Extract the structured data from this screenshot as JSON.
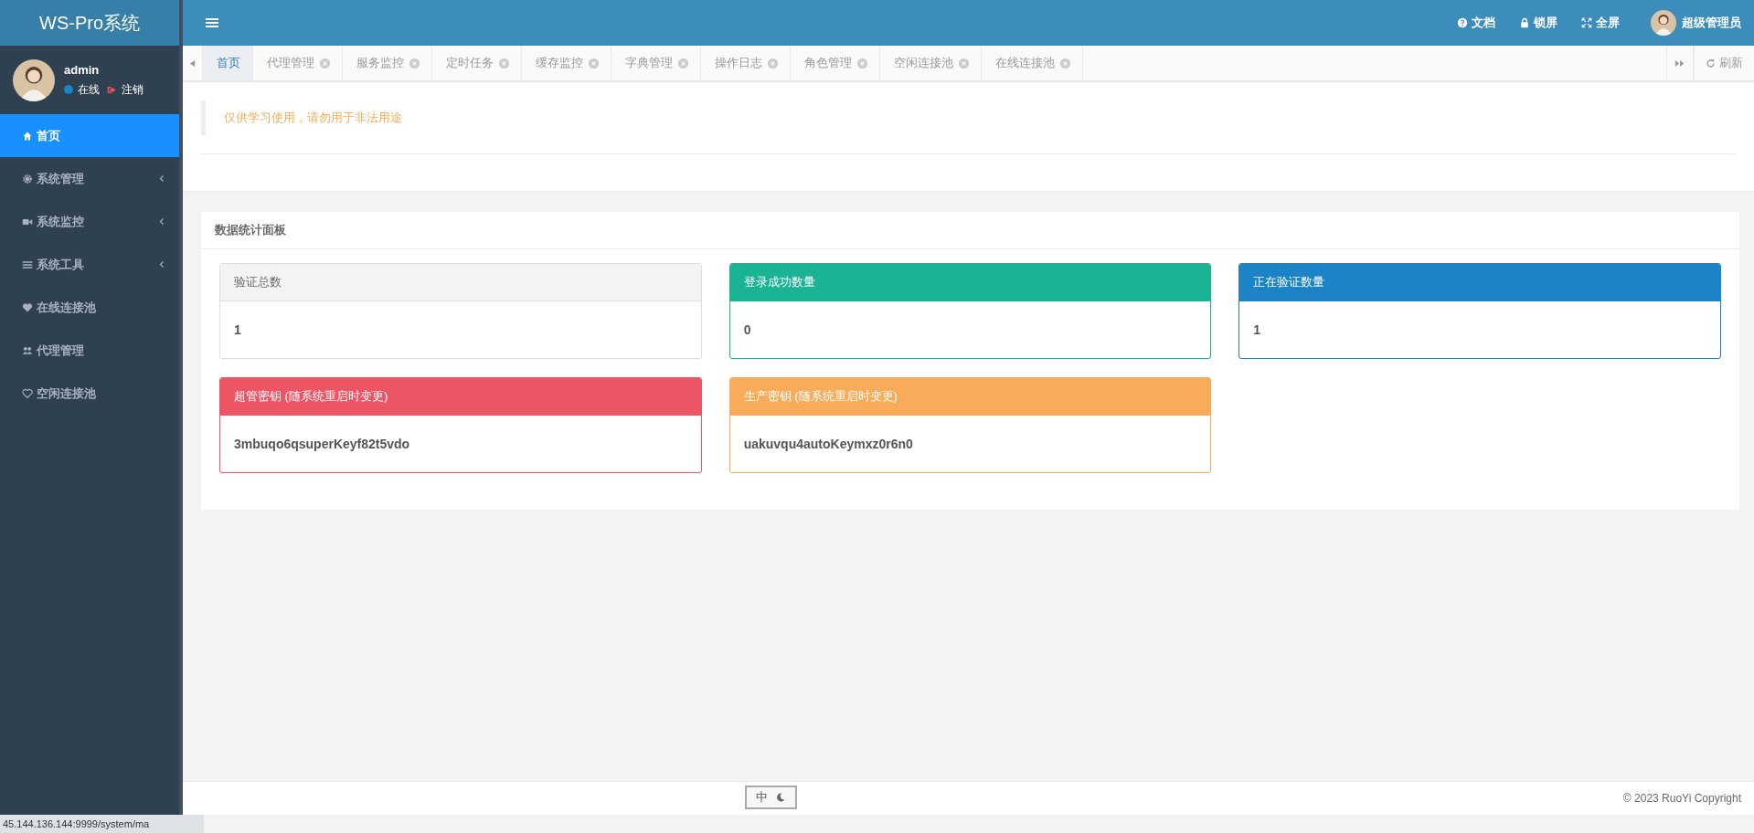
{
  "brand": "WS-Pro系统",
  "user": {
    "name": "admin",
    "status": "在线",
    "logout": "注销"
  },
  "sidebar": {
    "items": [
      {
        "label": "首页",
        "selected": true,
        "has_children": false
      },
      {
        "label": "系统管理",
        "selected": false,
        "has_children": true
      },
      {
        "label": "系统监控",
        "selected": false,
        "has_children": true
      },
      {
        "label": "系统工具",
        "selected": false,
        "has_children": true
      },
      {
        "label": "在线连接池",
        "selected": false,
        "has_children": false
      },
      {
        "label": "代理管理",
        "selected": false,
        "has_children": false
      },
      {
        "label": "空闲连接池",
        "selected": false,
        "has_children": false
      }
    ]
  },
  "header": {
    "actions": [
      {
        "label": "文档"
      },
      {
        "label": "锁屏"
      },
      {
        "label": "全屏"
      }
    ],
    "account": "超级管理员"
  },
  "tabs": [
    {
      "label": "首页",
      "selected": true,
      "closable": false
    },
    {
      "label": "代理管理",
      "selected": false,
      "closable": true
    },
    {
      "label": "服务监控",
      "selected": false,
      "closable": true
    },
    {
      "label": "定时任务",
      "selected": false,
      "closable": true
    },
    {
      "label": "缓存监控",
      "selected": false,
      "closable": true
    },
    {
      "label": "字典管理",
      "selected": false,
      "closable": true
    },
    {
      "label": "操作日志",
      "selected": false,
      "closable": true
    },
    {
      "label": "角色管理",
      "selected": false,
      "closable": true
    },
    {
      "label": "空闲连接池",
      "selected": false,
      "closable": true
    },
    {
      "label": "在线连接池",
      "selected": false,
      "closable": true
    }
  ],
  "refresh": "刷新",
  "notice": "仅供学习使用，请勿用于非法用途",
  "panel": {
    "title": "数据统计面板",
    "cards": [
      {
        "title": "验证总数",
        "value": "1",
        "color": "#f3f3f4"
      },
      {
        "title": "登录成功数量",
        "value": "0",
        "color": "#1ab394"
      },
      {
        "title": "正在验证数量",
        "value": "1",
        "color": "#1c84c6"
      },
      {
        "title": "超管密钥 (随系统重启时变更)",
        "value": "3mbuqo6qsuperKeyf82t5vdo",
        "color": "#ed5565"
      },
      {
        "title": "生产密钥 (随系统重启时变更)",
        "value": "uakuvqu4autoKeymxz0r6n0",
        "color": "#f8ac59"
      }
    ]
  },
  "ime": {
    "label": "中"
  },
  "footer": "© 2023 RuoYi Copyright",
  "status_url": "45.144.136.144:9999/system/ma"
}
